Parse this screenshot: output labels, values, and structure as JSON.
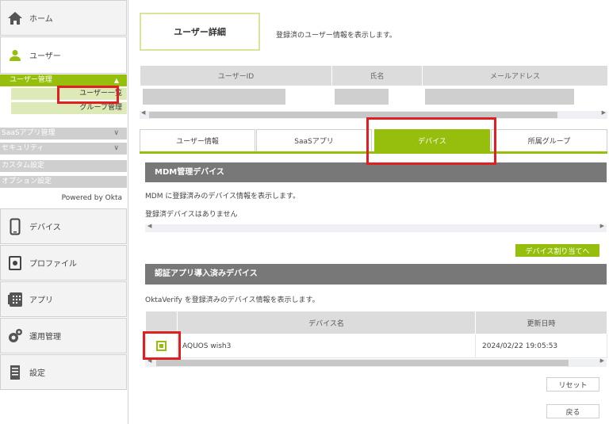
{
  "sidebar": {
    "home": "ホーム",
    "user": "ユーザー",
    "user_mgmt": "ユーザー管理",
    "user_list": "ユーザー一覧",
    "group_mgmt": "グループ管理",
    "saas_mgmt": "SaaSアプリ管理",
    "security": "セキュリティ",
    "custom": "カスタム設定",
    "options": "オプション設定",
    "powered": "Powered by Okta",
    "device": "デバイス",
    "profile": "プロファイル",
    "apps": "アプリ",
    "ops": "運用管理",
    "settings": "設定"
  },
  "header": {
    "title": "ユーザー詳細",
    "desc": "登録済のユーザー情報を表示します。"
  },
  "user_table": {
    "columns": [
      "ユーザーID",
      "氏名",
      "メールアドレス"
    ]
  },
  "tabs": [
    "ユーザー情報",
    "SaaSアプリ",
    "デバイス",
    "所属グループ"
  ],
  "mdm": {
    "title": "MDM管理デバイス",
    "desc": "MDM に登録済みのデバイス情報を表示します。",
    "empty": "登録済デバイスはありません",
    "assign_button": "デバイス割り当てへ"
  },
  "auth": {
    "title": "認証アプリ導入済みデバイス",
    "desc": "OktaVerify を登録済みのデバイス情報を表示します。",
    "columns": [
      "デバイス名",
      "更新日時"
    ],
    "rows": [
      {
        "name": "AQUOS wish3",
        "updated": "2024/02/22 19:05:53"
      }
    ]
  },
  "buttons": {
    "reset": "リセット",
    "back": "戻る"
  },
  "colors": {
    "accent": "#96bf0d",
    "highlight": "#e02020"
  }
}
